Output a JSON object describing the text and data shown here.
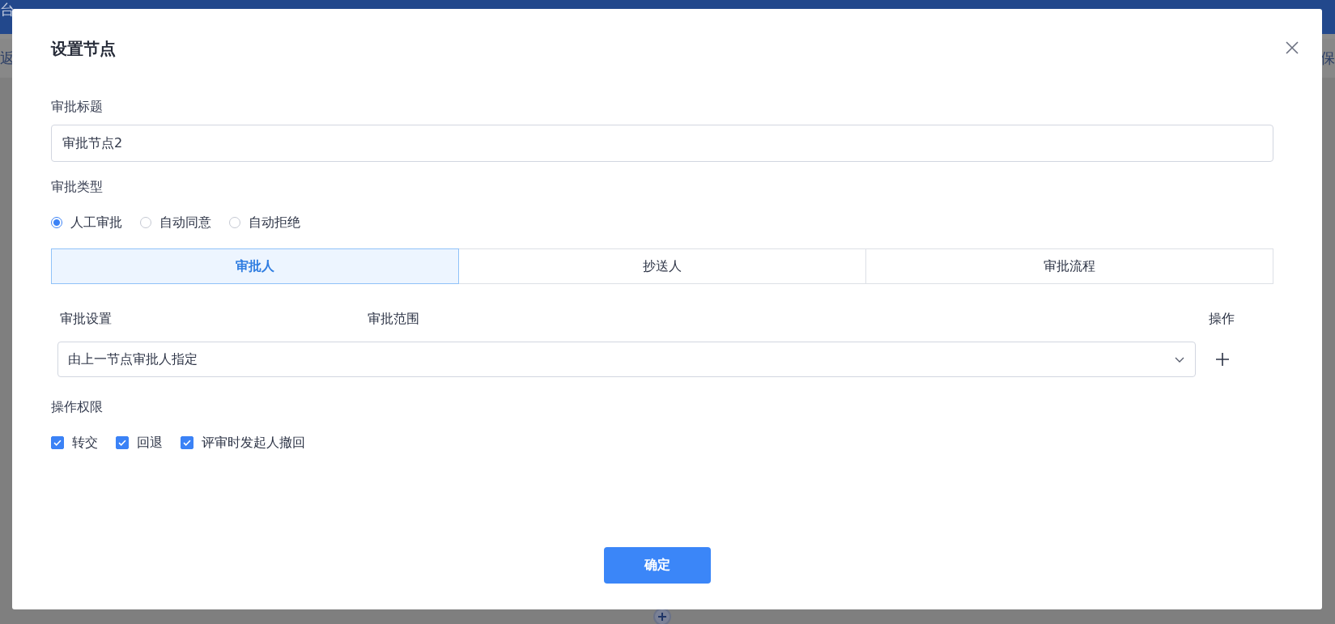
{
  "background": {
    "header_text": "台",
    "toolbar_left": "返",
    "toolbar_right": "保"
  },
  "dialog": {
    "title": "设置节点",
    "title_field": {
      "label": "审批标题",
      "value": "审批节点2"
    },
    "type_field": {
      "label": "审批类型",
      "options": [
        {
          "label": "人工审批",
          "selected": true
        },
        {
          "label": "自动同意",
          "selected": false
        },
        {
          "label": "自动拒绝",
          "selected": false
        }
      ]
    },
    "tabs": [
      {
        "label": "审批人",
        "selected": true
      },
      {
        "label": "抄送人",
        "selected": false
      },
      {
        "label": "审批流程",
        "selected": false
      }
    ],
    "table": {
      "columns": [
        "审批设置",
        "审批范围",
        "操作"
      ],
      "rows": [
        {
          "value": "由上一节点审批人指定"
        }
      ]
    },
    "permissions": {
      "label": "操作权限",
      "options": [
        {
          "label": "转交",
          "checked": true
        },
        {
          "label": "回退",
          "checked": true
        },
        {
          "label": "评审时发起人撤回",
          "checked": true
        }
      ]
    },
    "confirm_button": "确定"
  }
}
